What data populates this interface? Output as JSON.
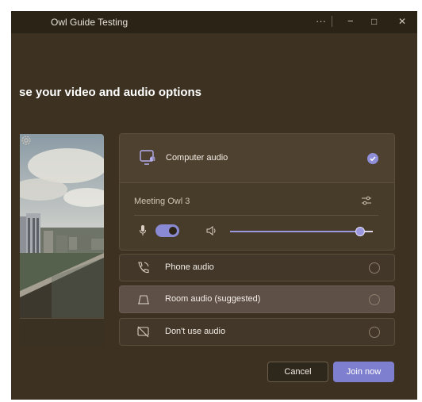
{
  "window": {
    "title": "Owl Guide Testing",
    "controls": {
      "more": "···",
      "minimize": "−",
      "maximize": "□",
      "close": "✕"
    }
  },
  "heading": "se your video and audio options",
  "audio_options": {
    "computer_audio": {
      "label": "Computer audio",
      "selected": true,
      "icon": "computer-audio-icon"
    },
    "device": {
      "label": "Meeting Owl 3",
      "settings_icon": "sliders-icon"
    },
    "mic": {
      "icon": "microphone-icon",
      "toggle_on": true
    },
    "speaker": {
      "icon": "speaker-icon",
      "volume": 0.91
    },
    "phone_audio": {
      "label": "Phone audio",
      "icon": "phone-icon"
    },
    "room_audio": {
      "label": "Room audio (suggested)",
      "icon": "room-icon"
    },
    "no_audio": {
      "label": "Don't use audio",
      "icon": "no-audio-icon"
    }
  },
  "preview": {
    "settings_icon": "gear-icon"
  },
  "buttons": {
    "cancel": "Cancel",
    "join": "Join now"
  },
  "colors": {
    "accent": "#8f8ed8",
    "background": "#3d3221",
    "titlebar": "#2b2416"
  }
}
